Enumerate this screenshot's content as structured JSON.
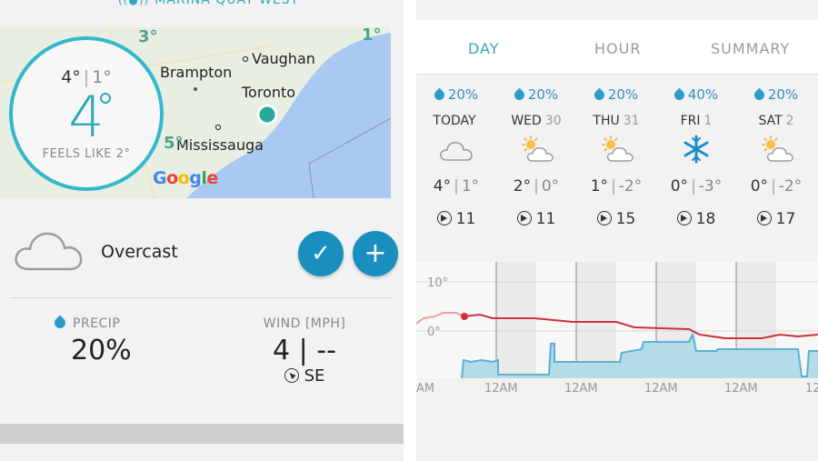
{
  "left": {
    "location_name": "MARINA QUAY WEST",
    "map": {
      "places": [
        "Brampton",
        "Vaughan",
        "Toronto",
        "Mississauga"
      ],
      "map_temps": [
        "3°",
        "1°",
        "5°"
      ],
      "provider": "Google"
    },
    "current": {
      "high": "4°",
      "low": "1°",
      "temp": "4",
      "feels_like": "FEELS LIKE 2°"
    },
    "condition": "Overcast",
    "precip": {
      "label": "PRECIP",
      "value": "20%"
    },
    "wind": {
      "label": "WIND [MPH]",
      "value": "4 | --",
      "direction": "SE"
    }
  },
  "right": {
    "tabs": [
      {
        "label": "DAY",
        "active": true
      },
      {
        "label": "HOUR",
        "active": false
      },
      {
        "label": "SUMMARY",
        "active": false
      }
    ],
    "days": [
      {
        "precip": "20%",
        "name": "TODAY",
        "num": "",
        "icon": "cloud-icon",
        "high": "4°",
        "low": "1°",
        "wind": "11"
      },
      {
        "precip": "20%",
        "name": "WED",
        "num": "30",
        "icon": "partly-sunny-icon",
        "high": "2°",
        "low": "0°",
        "wind": "11"
      },
      {
        "precip": "20%",
        "name": "THU",
        "num": "31",
        "icon": "partly-sunny-icon",
        "high": "1°",
        "low": "-2°",
        "wind": "15"
      },
      {
        "precip": "40%",
        "name": "FRI",
        "num": "1",
        "icon": "snowflake-icon",
        "high": "0°",
        "low": "-3°",
        "wind": "18"
      },
      {
        "precip": "20%",
        "name": "SAT",
        "num": "2",
        "icon": "partly-sunny-icon",
        "high": "0°",
        "low": "-2°",
        "wind": "17"
      }
    ],
    "chart": {
      "y_labels": [
        "10°",
        "0°"
      ],
      "x_labels": [
        "AM",
        "12AM",
        "12AM",
        "12AM",
        "12AM",
        "12"
      ],
      "colors": {
        "temp_past": "#e8a0a0",
        "temp": "#c9333a",
        "precip_line": "#5ab2d4",
        "precip_fill": "#b5dbe8"
      }
    }
  }
}
